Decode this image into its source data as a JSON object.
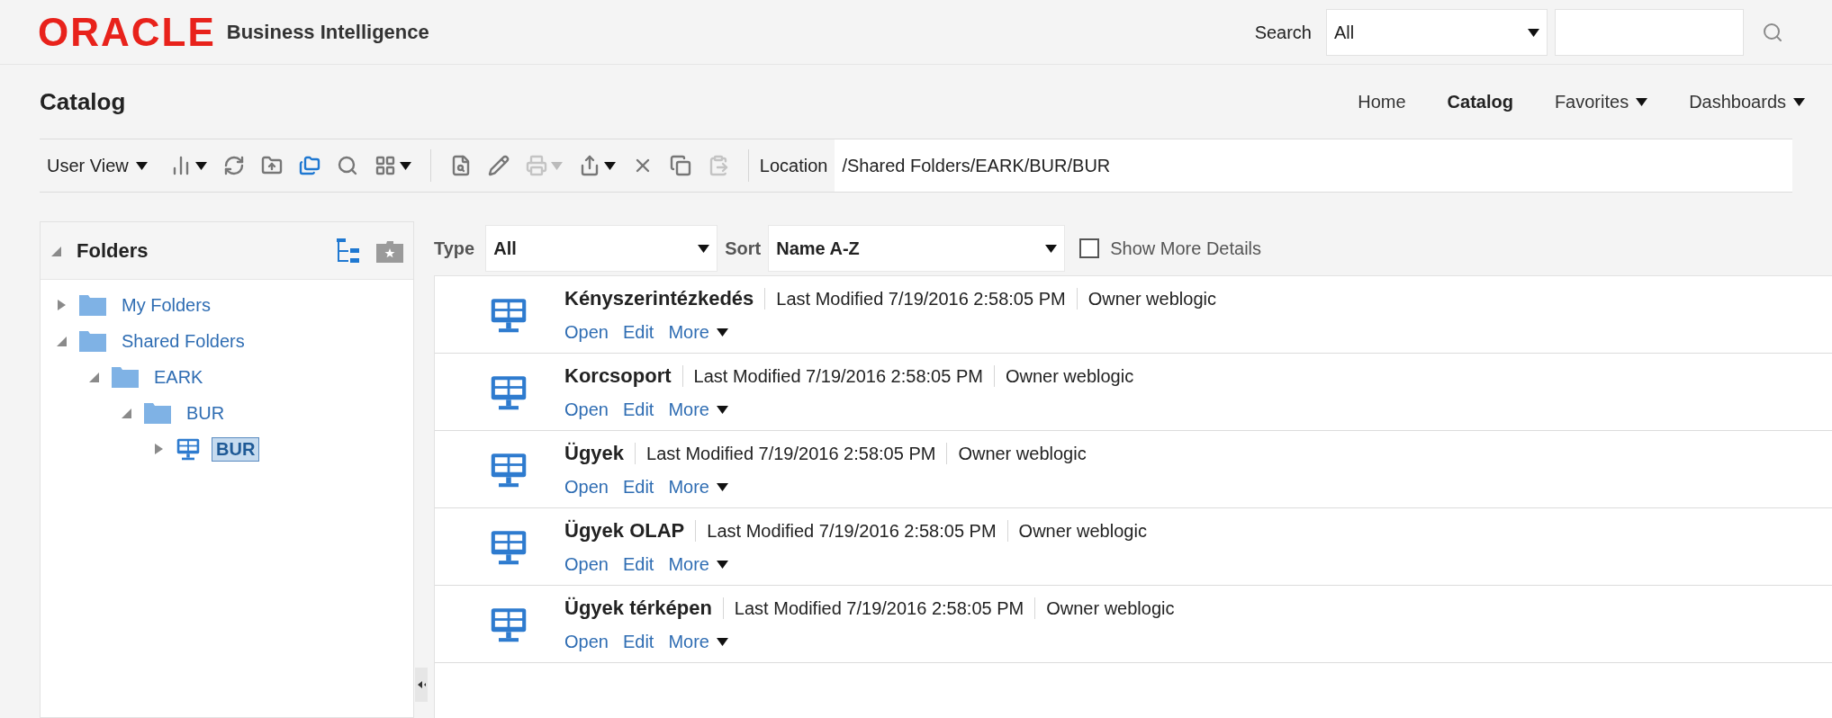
{
  "header": {
    "logo": "ORACLE",
    "product": "Business Intelligence",
    "search_label": "Search",
    "search_scope": "All"
  },
  "page_title": "Catalog",
  "nav": [
    {
      "label": "Home",
      "selected": false,
      "dropdown": false
    },
    {
      "label": "Catalog",
      "selected": true,
      "dropdown": false
    },
    {
      "label": "Favorites",
      "selected": false,
      "dropdown": true
    },
    {
      "label": "Dashboards",
      "selected": false,
      "dropdown": true
    }
  ],
  "toolbar": {
    "view_menu": "User View",
    "location_label": "Location",
    "location": "/Shared Folders/EARK/BUR/BUR",
    "actions": [
      {
        "kind": "columns",
        "disabled": false,
        "dropdown": true
      },
      {
        "kind": "refresh",
        "disabled": false,
        "dropdown": false
      },
      {
        "kind": "upload",
        "disabled": false,
        "dropdown": false
      },
      {
        "kind": "folders",
        "disabled": false,
        "dropdown": false
      },
      {
        "kind": "search",
        "disabled": false,
        "dropdown": false
      },
      {
        "kind": "grid",
        "disabled": false,
        "dropdown": true
      },
      {
        "kind": "separator"
      },
      {
        "kind": "properties",
        "disabled": false,
        "dropdown": false
      },
      {
        "kind": "edit",
        "disabled": false,
        "dropdown": false
      },
      {
        "kind": "print",
        "disabled": true,
        "dropdown": true
      },
      {
        "kind": "share",
        "disabled": false,
        "dropdown": true
      },
      {
        "kind": "delete",
        "disabled": false,
        "dropdown": false
      },
      {
        "kind": "copy",
        "disabled": false,
        "dropdown": false
      },
      {
        "kind": "paste",
        "disabled": true,
        "dropdown": false
      }
    ]
  },
  "folders": {
    "title": "Folders",
    "tree": [
      {
        "label": "My Folders",
        "kind": "folder",
        "expanded": false,
        "selected": false
      },
      {
        "label": "Shared Folders",
        "kind": "folder",
        "expanded": true,
        "selected": false,
        "children": [
          {
            "label": "EARK",
            "kind": "folder",
            "expanded": true,
            "selected": false,
            "children": [
              {
                "label": "BUR",
                "kind": "folder",
                "expanded": true,
                "selected": false,
                "children": [
                  {
                    "label": "BUR",
                    "kind": "dashboard",
                    "expanded": false,
                    "selected": true
                  }
                ]
              }
            ]
          }
        ]
      }
    ]
  },
  "filters": {
    "type_label": "Type",
    "type_value": "All",
    "sort_label": "Sort",
    "sort_value": "Name A-Z",
    "show_more_details": {
      "label": "Show More Details",
      "checked": false
    }
  },
  "items": [
    {
      "name": "Kényszerintézkedés",
      "modified": "Last Modified 7/19/2016 2:58:05 PM",
      "owner": "Owner weblogic",
      "actions": [
        "Open",
        "Edit",
        "More"
      ]
    },
    {
      "name": "Korcsoport",
      "modified": "Last Modified 7/19/2016 2:58:05 PM",
      "owner": "Owner weblogic",
      "actions": [
        "Open",
        "Edit",
        "More"
      ]
    },
    {
      "name": "Ügyek",
      "modified": "Last Modified 7/19/2016 2:58:05 PM",
      "owner": "Owner weblogic",
      "actions": [
        "Open",
        "Edit",
        "More"
      ]
    },
    {
      "name": "Ügyek OLAP",
      "modified": "Last Modified 7/19/2016 2:58:05 PM",
      "owner": "Owner weblogic",
      "actions": [
        "Open",
        "Edit",
        "More"
      ]
    },
    {
      "name": "Ügyek térképen",
      "modified": "Last Modified 7/19/2016 2:58:05 PM",
      "owner": "Owner weblogic",
      "actions": [
        "Open",
        "Edit",
        "More"
      ]
    }
  ]
}
